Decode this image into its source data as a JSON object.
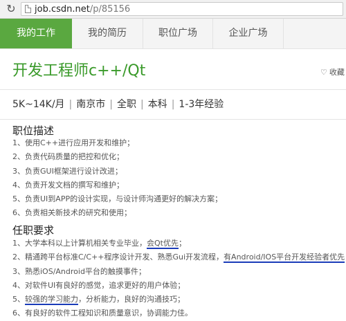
{
  "browser": {
    "reload_icon": "reload-icon",
    "url_domain": "job.csdn.net",
    "url_path": "/p/85156"
  },
  "nav": {
    "tabs": [
      {
        "label": "我的工作",
        "active": true
      },
      {
        "label": "我的简历",
        "active": false
      },
      {
        "label": "职位广场",
        "active": false
      },
      {
        "label": "企业广场",
        "active": false
      }
    ],
    "active_color": "#5aa840"
  },
  "job": {
    "title": "开发工程师c++/Qt",
    "favorite_label": "收藏",
    "favorite_icon": "heart-outline-icon",
    "salary": "5K~14K/月",
    "city": "南京市",
    "type": "全职",
    "education": "本科",
    "experience": "1-3年经验",
    "title_color": "#3a9a2a"
  },
  "description": {
    "heading": "职位描述",
    "items": [
      "1、使用C++进行应用开发和维护；",
      "2、负责代码质量的把控和优化；",
      "3、负责GUI框架进行设计改进；",
      "4、负责开发文档的撰写和维护；",
      "5、负责UI到APP的设计实现，与设计师沟通更好的解决方案；",
      "6、负责相关新技术的研究和使用；"
    ]
  },
  "requirements": {
    "heading": "任职要求",
    "items": [
      {
        "pre": "1、大学本科以上计算机相关专业毕业，",
        "hl": "会Qt优先",
        "post": "；"
      },
      {
        "pre": "2、精通跨平台标准C/C++程序设计开发、熟悉Gui开发流程，",
        "hl": "有Android/IOS平台开发经验者优先",
        "post": "；"
      },
      {
        "pre": "3、熟悉iOS/Android平台的触摸事件；",
        "hl": "",
        "post": ""
      },
      {
        "pre": "4、对软件UI有良好的感觉，追求更好的用户体验；",
        "hl": "",
        "post": ""
      },
      {
        "pre": "5、",
        "hl": "较强的学习能力",
        "post": "，分析能力，良好的沟通技巧；"
      },
      {
        "pre": "6、有良好的软件工程知识和质量意识，协调能力佳。",
        "hl": "",
        "post": ""
      }
    ],
    "underline_color": "#1a3bb8"
  }
}
